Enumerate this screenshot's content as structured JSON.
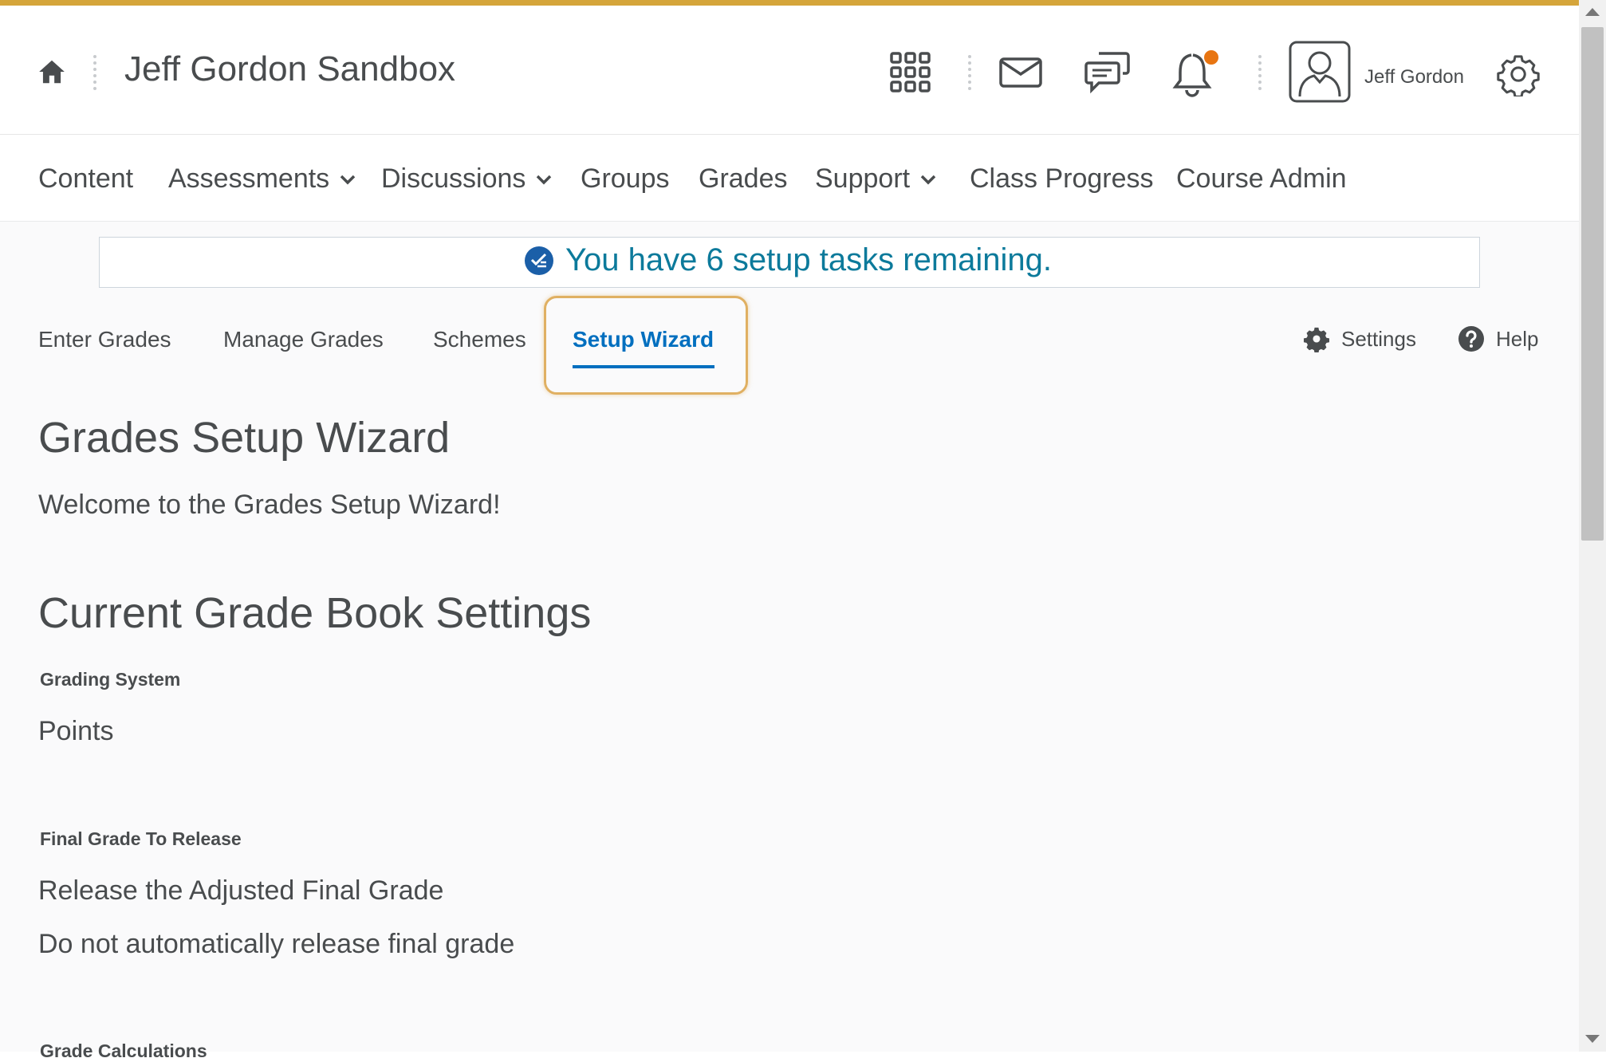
{
  "header": {
    "site_title": "Jeff Gordon Sandbox",
    "user_name": "Jeff Gordon",
    "accent_color": "#d5a53a",
    "notification_dot_color": "#e87511"
  },
  "nav": {
    "items": [
      {
        "label": "Content",
        "has_dropdown": false
      },
      {
        "label": "Assessments",
        "has_dropdown": true
      },
      {
        "label": "Discussions",
        "has_dropdown": true
      },
      {
        "label": "Groups",
        "has_dropdown": false
      },
      {
        "label": "Grades",
        "has_dropdown": false
      },
      {
        "label": "Support",
        "has_dropdown": true
      },
      {
        "label": "Class Progress",
        "has_dropdown": false
      },
      {
        "label": "Course Admin",
        "has_dropdown": false
      }
    ]
  },
  "banner": {
    "text": "You have 6 setup tasks remaining."
  },
  "subtabs": {
    "items": [
      "Enter Grades",
      "Manage Grades",
      "Schemes",
      "Setup Wizard"
    ],
    "active": "Setup Wizard",
    "settings_label": "Settings",
    "help_label": "Help"
  },
  "main": {
    "title": "Grades Setup Wizard",
    "welcome": "Welcome to the Grades Setup Wizard!",
    "section_title": "Current Grade Book Settings",
    "grading_system_label": "Grading System",
    "grading_system_value": "Points",
    "final_grade_label": "Final Grade To Release",
    "final_grade_value": "Release the Adjusted Final Grade",
    "auto_release_value": "Do not automatically release final grade",
    "grade_calculations_label": "Grade Calculations"
  }
}
